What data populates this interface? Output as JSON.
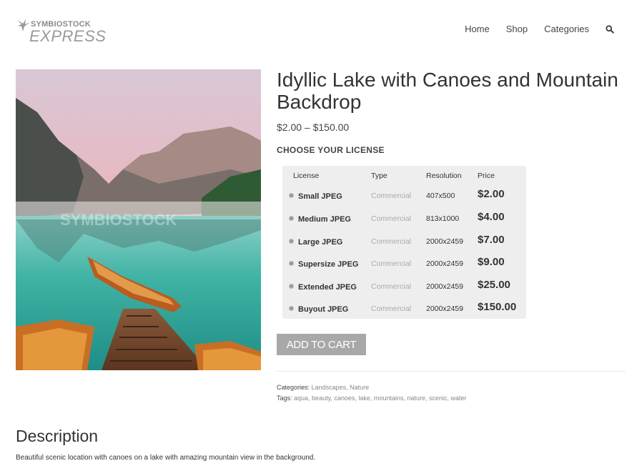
{
  "header": {
    "brand_top": "SYMBIOSTOCK",
    "brand_bottom": "EXPRESS",
    "nav": [
      "Home",
      "Shop",
      "Categories"
    ],
    "search_icon": "search-icon"
  },
  "product": {
    "image_watermark": "SYMBIOSTOCK",
    "title": "Idyllic Lake with Canoes and Mountain Backdrop",
    "price_range": "$2.00 – $150.00",
    "license_heading": "CHOOSE YOUR LICENSE",
    "license_table": {
      "headers": [
        "License",
        "Type",
        "Resolution",
        "Price"
      ],
      "rows": [
        {
          "name": "Small JPEG",
          "type": "Commercial",
          "resolution": "407x500",
          "price": "$2.00"
        },
        {
          "name": "Medium JPEG",
          "type": "Commercial",
          "resolution": "813x1000",
          "price": "$4.00"
        },
        {
          "name": "Large JPEG",
          "type": "Commercial",
          "resolution": "2000x2459",
          "price": "$7.00"
        },
        {
          "name": "Supersize JPEG",
          "type": "Commercial",
          "resolution": "2000x2459",
          "price": "$9.00"
        },
        {
          "name": "Extended JPEG",
          "type": "Commercial",
          "resolution": "2000x2459",
          "price": "$25.00"
        },
        {
          "name": "Buyout JPEG",
          "type": "Commercial",
          "resolution": "2000x2459",
          "price": "$150.00"
        }
      ]
    },
    "add_to_cart": "ADD TO CART",
    "categories_label": "Categories:",
    "categories": "Landscapes, Nature",
    "tags_label": "Tags:",
    "tags": "aqua, beauty, canoes, lake, mountains, nature, scenic, water"
  },
  "description": {
    "heading": "Description",
    "text": "Beautiful scenic location with canoes on a lake with amazing mountain view in the background."
  },
  "colors": {
    "button_bg": "#a8a8a8",
    "table_bg": "#eeeeee",
    "link_gray": "#888888"
  }
}
